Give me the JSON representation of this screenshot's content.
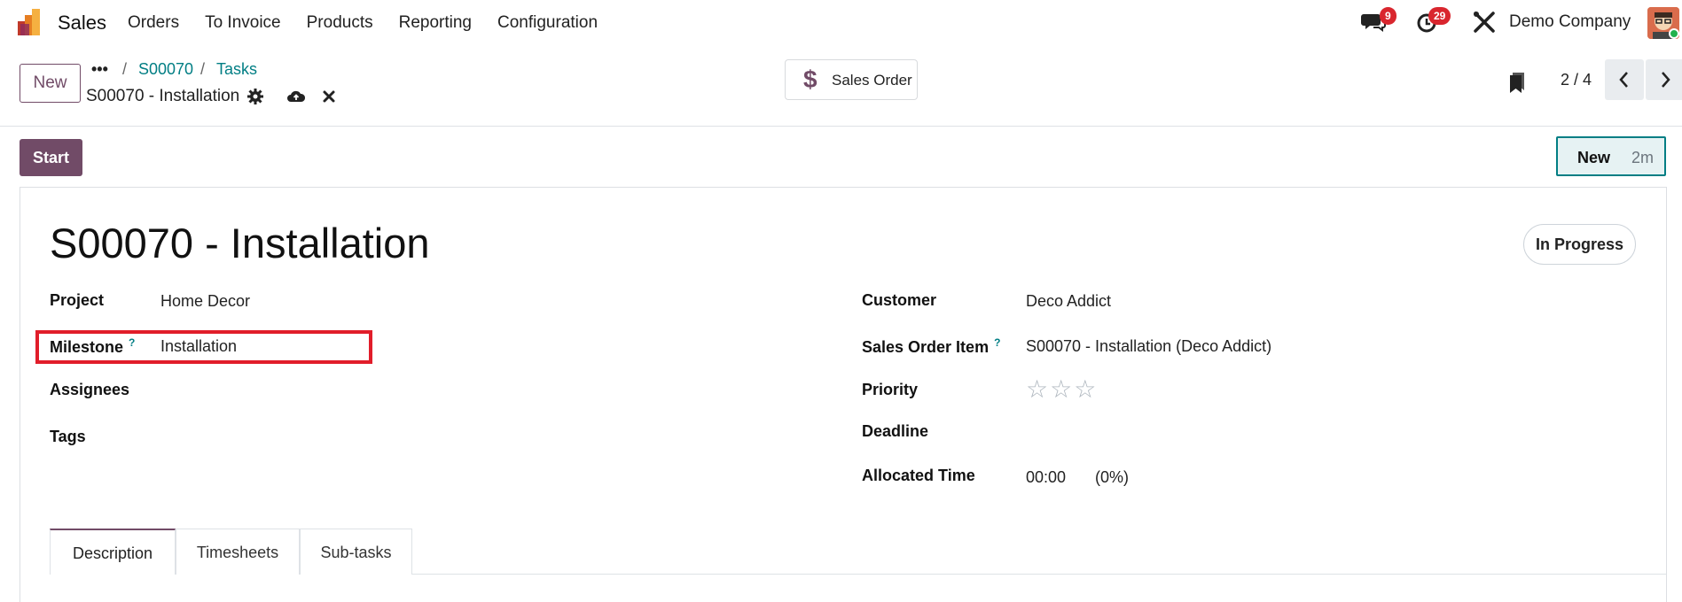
{
  "navbar": {
    "app_name": "Sales",
    "menu": [
      "Orders",
      "To Invoice",
      "Products",
      "Reporting",
      "Configuration"
    ],
    "messages_count": "9",
    "activities_count": "29",
    "company": "Demo Company"
  },
  "control_panel": {
    "new_label": "New",
    "breadcrumb_dots": "•••",
    "breadcrumb": [
      "S00070",
      "Tasks"
    ],
    "record_name": "S00070 - Installation",
    "smart_button_label": "Sales Order",
    "pager": "2 / 4"
  },
  "statusbar": {
    "start_label": "Start",
    "stage_name": "New",
    "stage_time": "2m"
  },
  "form": {
    "title": "S00070 - Installation",
    "state": "In Progress",
    "left": {
      "project_label": "Project",
      "project_value": "Home Decor",
      "milestone_label": "Milestone",
      "milestone_help": "?",
      "milestone_value": "Installation",
      "assignees_label": "Assignees",
      "tags_label": "Tags"
    },
    "right": {
      "customer_label": "Customer",
      "customer_value": "Deco Addict",
      "soi_label": "Sales Order Item",
      "soi_help": "?",
      "soi_value": "S00070 - Installation (Deco Addict)",
      "priority_label": "Priority",
      "priority_stars": "☆☆☆",
      "deadline_label": "Deadline",
      "allocated_label": "Allocated Time",
      "allocated_value": "00:00",
      "allocated_percent": "(0%)"
    },
    "tabs": [
      "Description",
      "Timesheets",
      "Sub-tasks"
    ]
  },
  "colors": {
    "brand": "#714b67",
    "link": "#017e84",
    "badge": "#d9262e",
    "highlight": "#e11d2a"
  }
}
